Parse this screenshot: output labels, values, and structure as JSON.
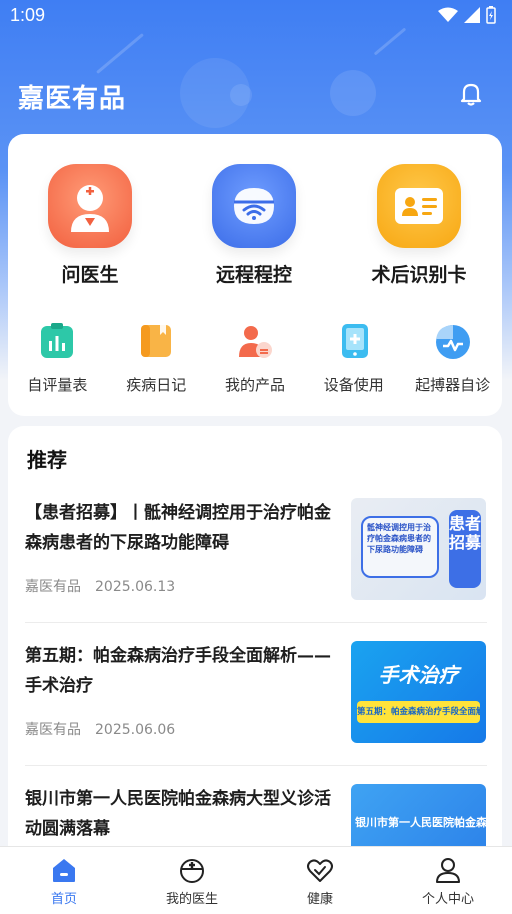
{
  "status_bar": {
    "time": "1:09"
  },
  "header": {
    "title": "嘉医有品"
  },
  "big_features": [
    {
      "label": "问医生",
      "icon": "doctor-icon"
    },
    {
      "label": "远程程控",
      "icon": "remote-control-icon"
    },
    {
      "label": "术后识别卡",
      "icon": "id-card-icon"
    }
  ],
  "small_features": [
    {
      "label": "自评量表",
      "icon": "chart-clipboard-icon"
    },
    {
      "label": "疾病日记",
      "icon": "diary-icon"
    },
    {
      "label": "我的产品",
      "icon": "product-user-icon"
    },
    {
      "label": "设备使用",
      "icon": "tablet-plus-icon"
    },
    {
      "label": "起搏器自诊",
      "icon": "pacemaker-icon"
    }
  ],
  "recommend": {
    "title": "推荐",
    "articles": [
      {
        "title": "【患者招募】丨骶神经调控用于治疗帕金森病患者的下尿路功能障碍",
        "source": "嘉医有品",
        "date": "2025.06.13",
        "thumb_text_main": "患者招募",
        "thumb_text_sub": "骶神经调控用于治疗帕金森病患者的下尿路功能障碍"
      },
      {
        "title": "第五期：帕金森病治疗手段全面解析——手术治疗",
        "source": "嘉医有品",
        "date": "2025.06.06",
        "thumb_text_main": "手术治疗",
        "thumb_text_sub": "第五期：帕金森病治疗手段全面解析"
      },
      {
        "title": "银川市第一人民医院帕金森病大型义诊活动圆满落幕",
        "source": "",
        "date": "",
        "thumb_text_main": "银川市第一人民医院帕金森病",
        "thumb_text_sub": ""
      }
    ]
  },
  "bottom_nav": [
    {
      "label": "首页",
      "icon": "home-icon",
      "active": true
    },
    {
      "label": "我的医生",
      "icon": "doctor-cap-icon",
      "active": false
    },
    {
      "label": "健康",
      "icon": "heart-icon",
      "active": false
    },
    {
      "label": "个人中心",
      "icon": "person-icon",
      "active": false
    }
  ],
  "colors": {
    "primary": "#3a78f0",
    "header_gradient_top": "#3f7ef3"
  }
}
